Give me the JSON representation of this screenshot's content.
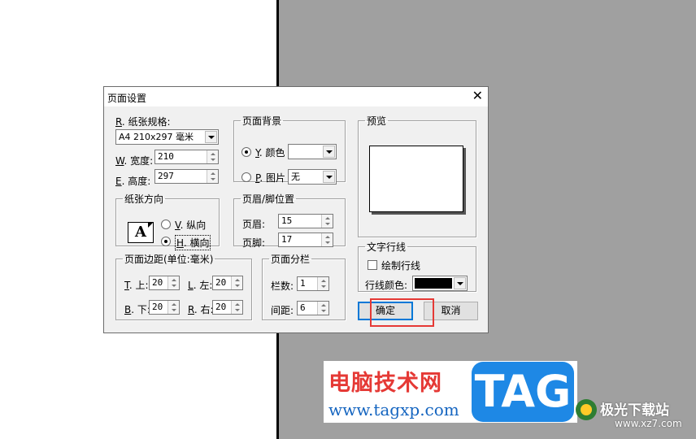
{
  "dialog": {
    "title": "页面设置",
    "close_glyph": "✕",
    "paper": {
      "label_key": "R",
      "label": ". 纸张规格:",
      "size_value": "A4 210x297 毫米",
      "width_key": "W",
      "width_label": ". 宽度:",
      "width_value": "210",
      "height_key": "E",
      "height_label": ". 高度:",
      "height_value": "297"
    },
    "background": {
      "legend": "页面背景",
      "color_key": "Y",
      "color_label": ". 颜色",
      "color_value": "#ffffff",
      "image_key": "P",
      "image_label": ". 图片",
      "image_value": "无",
      "selected": "color"
    },
    "preview": {
      "legend": "预览"
    },
    "orientation": {
      "legend": "纸张方向",
      "icon_letter": "A",
      "portrait_key": "V",
      "portrait_label": ". 纵向",
      "landscape_key": "H",
      "landscape_label": ". 横向",
      "selected": "landscape"
    },
    "header_footer": {
      "legend": "页眉/脚位置",
      "header_label": "页眉:",
      "header_value": "15",
      "footer_label": "页脚:",
      "footer_value": "17"
    },
    "text_lines": {
      "legend": "文字行线",
      "draw_label": "绘制行线",
      "draw_checked": false,
      "color_label": "行线颜色:",
      "color_value": "#000000"
    },
    "margins": {
      "legend": "页面边距(单位:毫米)",
      "top_key": "T",
      "top_label": ". 上:",
      "top_value": "20",
      "left_key": "L",
      "left_label": ". 左:",
      "left_value": "20",
      "bottom_key": "B",
      "bottom_label": ". 下:",
      "bottom_value": "20",
      "right_key": "R",
      "right_label": ". 右:",
      "right_value": "20"
    },
    "columns": {
      "legend": "页面分栏",
      "count_label": "栏数:",
      "count_value": "1",
      "spacing_label": "间距:",
      "spacing_value": "6"
    },
    "buttons": {
      "ok": "确定",
      "cancel": "取消"
    }
  },
  "watermark": {
    "text_cn": "电脑技术网",
    "url": "www.tagxp.com",
    "tag": "TAG",
    "site_name": "极光下载站",
    "site_url": "www.xz7.com"
  },
  "colors": {
    "highlight": "#e53935",
    "workspace": "#a0a0a0",
    "dialog_bg": "#f0f0f0"
  }
}
